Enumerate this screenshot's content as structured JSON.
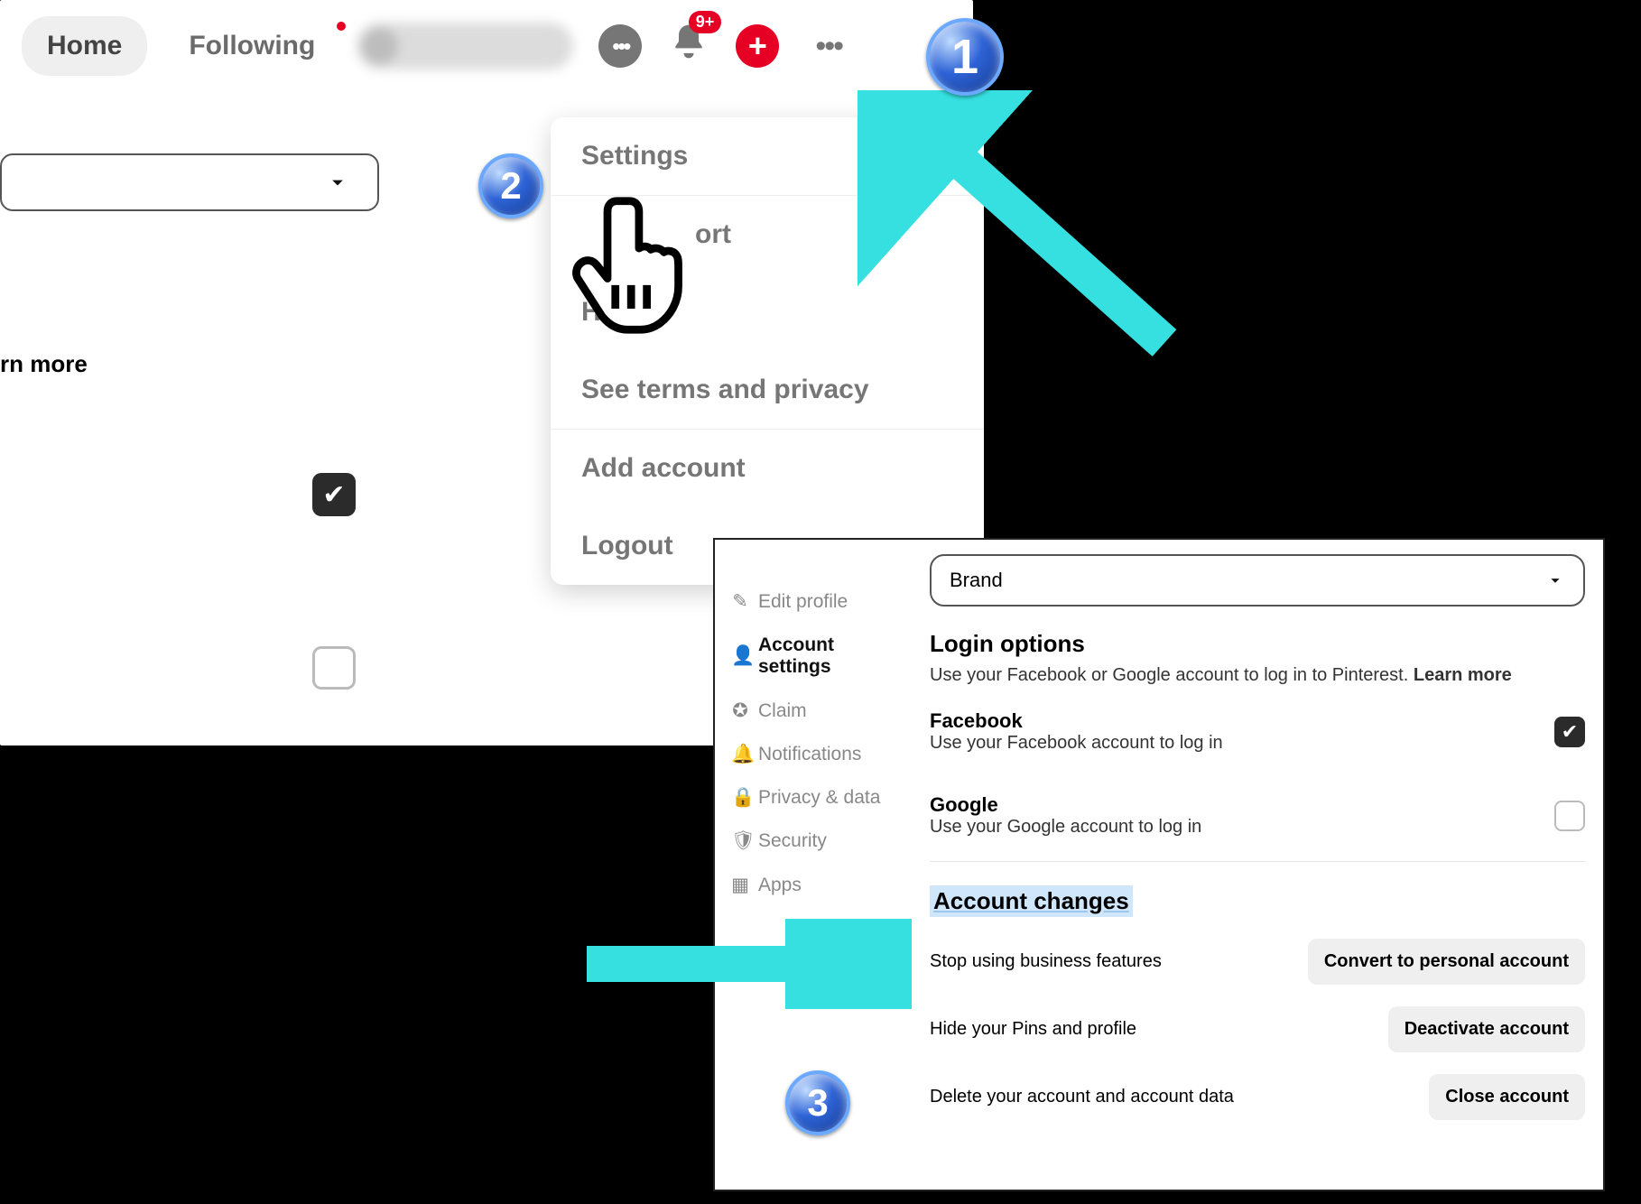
{
  "nav": {
    "home": "Home",
    "following": "Following",
    "notif_badge": "9+",
    "plus": "+"
  },
  "panel1": {
    "learn_more": "rn more",
    "checkbox1_checked": true,
    "checkbox2_checked": false
  },
  "menu": {
    "settings": "Settings",
    "support_partial": "ort",
    "help": "Help",
    "terms": "See terms and privacy",
    "add_account": "Add account",
    "logout": "Logout"
  },
  "steps": {
    "s1": "1",
    "s2": "2",
    "s3": "3"
  },
  "settings": {
    "brand_select": "Brand",
    "sidebar": [
      {
        "icon": "✎",
        "label": "Edit profile",
        "active": false
      },
      {
        "icon": "👤",
        "label": "Account settings",
        "active": true
      },
      {
        "icon": "✪",
        "label": "Claim",
        "active": false
      },
      {
        "icon": "🔔",
        "label": "Notifications",
        "active": false
      },
      {
        "icon": "🔒",
        "label": "Privacy & data",
        "active": false
      },
      {
        "icon": "🛡",
        "label": "Security",
        "active": false
      },
      {
        "icon": "▦",
        "label": "Apps",
        "active": false
      }
    ],
    "login_options": {
      "title": "Login options",
      "subtitle_pre": "Use your Facebook or Google account to log in to Pinterest. ",
      "subtitle_link": "Learn more",
      "facebook": {
        "name": "Facebook",
        "desc": "Use your Facebook account to log in",
        "checked": true
      },
      "google": {
        "name": "Google",
        "desc": "Use your Google account to log in",
        "checked": false
      }
    },
    "account_changes": {
      "title": "Account changes",
      "rows": [
        {
          "label": "Stop using business features",
          "button": "Convert to personal account"
        },
        {
          "label": "Hide your Pins and profile",
          "button": "Deactivate account"
        },
        {
          "label": "Delete your account and account data",
          "button": "Close account"
        }
      ]
    }
  }
}
